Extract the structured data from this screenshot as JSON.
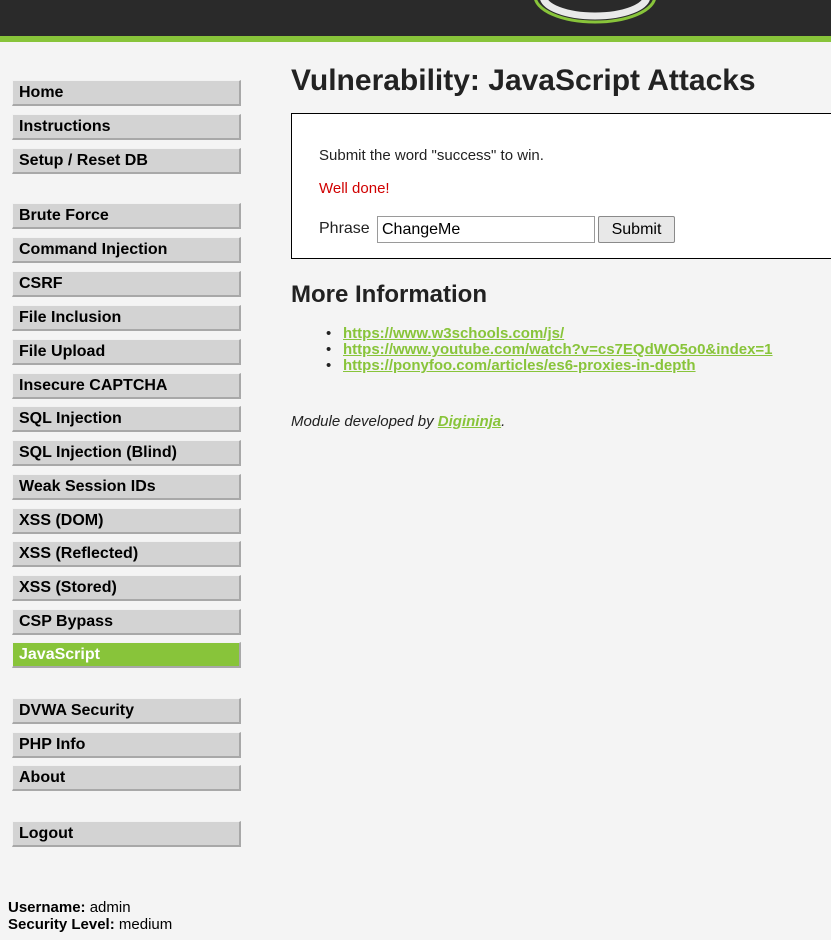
{
  "colors": {
    "accent": "#88c43a",
    "header_bg": "#2a2a2a",
    "error": "#d00000"
  },
  "menu": {
    "items": [
      {
        "label": "Home"
      },
      {
        "label": "Instructions"
      },
      {
        "label": "Setup / Reset DB"
      },
      {
        "label": "Brute Force"
      },
      {
        "label": "Command Injection"
      },
      {
        "label": "CSRF"
      },
      {
        "label": "File Inclusion"
      },
      {
        "label": "File Upload"
      },
      {
        "label": "Insecure CAPTCHA"
      },
      {
        "label": "SQL Injection"
      },
      {
        "label": "SQL Injection (Blind)"
      },
      {
        "label": "Weak Session IDs"
      },
      {
        "label": "XSS (DOM)"
      },
      {
        "label": "XSS (Reflected)"
      },
      {
        "label": "XSS (Stored)"
      },
      {
        "label": "CSP Bypass"
      },
      {
        "label": "JavaScript",
        "selected": true
      },
      {
        "label": "DVWA Security"
      },
      {
        "label": "PHP Info"
      },
      {
        "label": "About"
      },
      {
        "label": "Logout"
      }
    ]
  },
  "user": {
    "username_label": "Username:",
    "username": "admin",
    "security_label": "Security Level:",
    "security": "medium"
  },
  "main": {
    "title": "Vulnerability: JavaScript Attacks",
    "instruction": "Submit the word \"success\" to win.",
    "message": "Well done!",
    "phrase_label": "Phrase",
    "phrase_value": "ChangeMe",
    "submit_label": "Submit",
    "more_info_title": "More Information",
    "links": [
      "https://www.w3schools.com/js/",
      "https://www.youtube.com/watch?v=cs7EQdWO5o0&index=1",
      "https://ponyfoo.com/articles/es6-proxies-in-depth"
    ],
    "credit_prefix": "Module developed by ",
    "credit_author": "Digininja",
    "credit_suffix": "."
  }
}
